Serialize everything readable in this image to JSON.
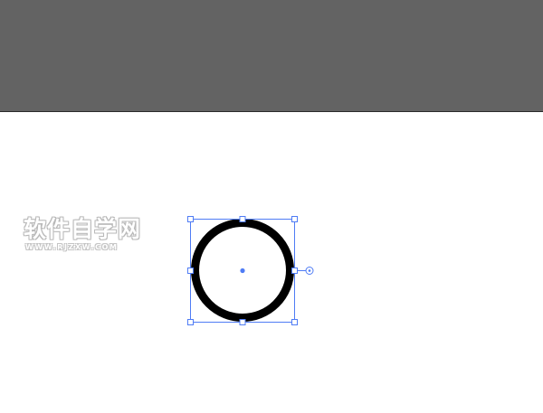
{
  "watermark": {
    "title": "软件自学网",
    "url": "WWW.RJZXW.COM"
  },
  "selection": {
    "accent_color": "#4f7cf5"
  },
  "shape": {
    "type": "ellipse",
    "stroke_color": "#000000",
    "fill_color": "#ffffff"
  }
}
